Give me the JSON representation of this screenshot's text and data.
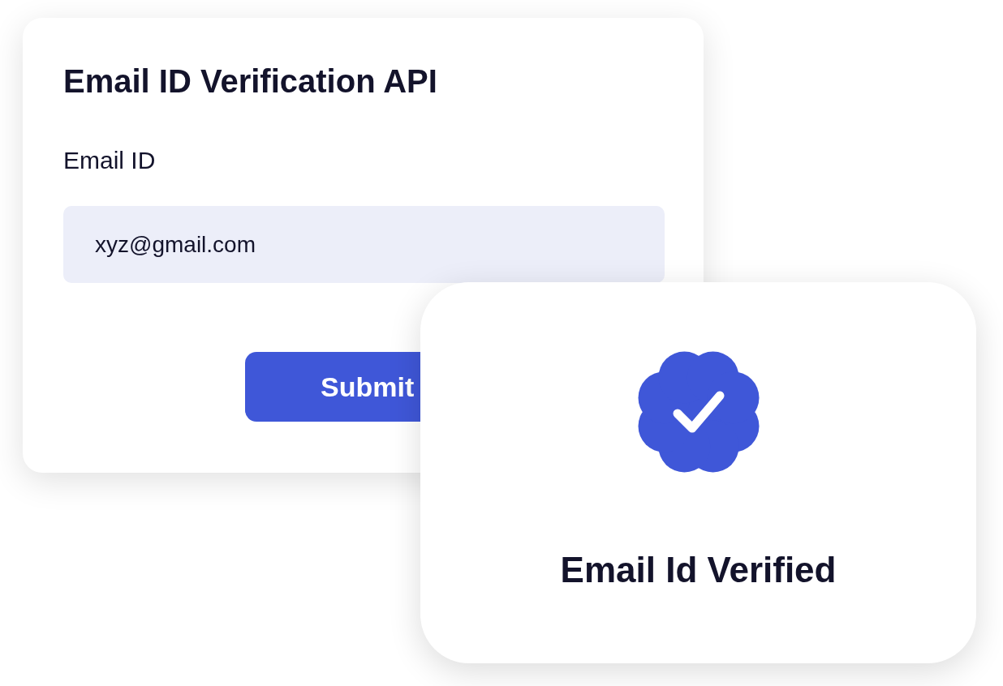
{
  "form_card": {
    "title": "Email ID Verification API",
    "field_label": "Email ID",
    "email_value": "xyz@gmail.com",
    "submit_button": "Submit"
  },
  "result_card": {
    "verified": true,
    "message": "Email Id Verified"
  }
}
